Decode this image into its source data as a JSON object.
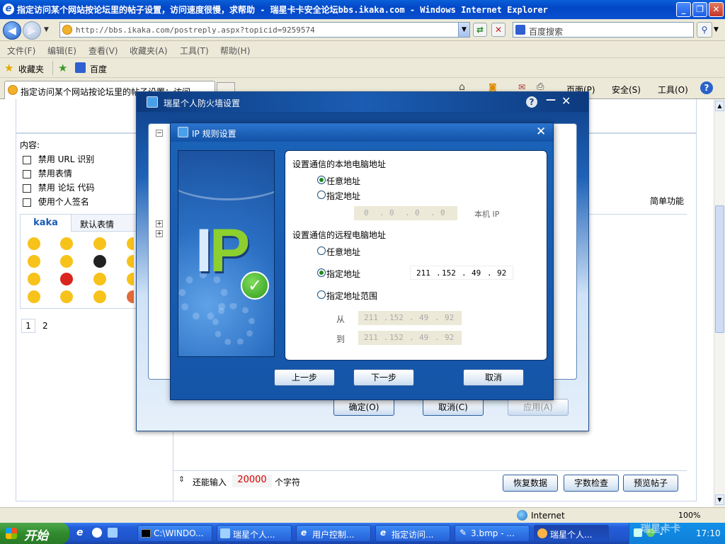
{
  "ie": {
    "title": "指定访问某个网站按论坛里的帖子设置，访问速度很慢，求帮助 - 瑞星卡卡安全论坛bbs.ikaka.com - Windows Internet Explorer",
    "url": "http://bbs.ikaka.com/postreply.aspx?topicid=9259574",
    "search_placeholder": "百度搜索",
    "menu": [
      "文件(F)",
      "编辑(E)",
      "查看(V)",
      "收藏夹(A)",
      "工具(T)",
      "帮助(H)"
    ],
    "favorites_label": "收藏夹",
    "favorite_link": "百度",
    "tab_title": "指定访问某个网站按论坛里的帖子设置：访问...",
    "cmd": {
      "page": "页面(P)",
      "safety": "安全(S)",
      "tools": "工具(O)"
    },
    "status_zone": "Internet",
    "zoom": "100%"
  },
  "forum": {
    "content_label": "内容:",
    "options": [
      "禁用 URL 识别",
      "禁用表情",
      "禁用 论坛 代码",
      "使用个人签名"
    ],
    "smiley_tabs": [
      "kaka",
      "默认表情"
    ],
    "pages": [
      "1",
      "2"
    ],
    "simple_function": "简单功能",
    "remaining_prefix": "还能输入",
    "remaining_count": "20000",
    "remaining_suffix": "个字符",
    "buttons": [
      "恢复数据",
      "字数检查",
      "预览帖子"
    ],
    "partial_link": "认"
  },
  "firewall": {
    "title": "瑞星个人防火墙设置",
    "ok": "确定(O)",
    "cancel": "取消(C)",
    "apply": "应用(A)"
  },
  "ip_rule": {
    "title": "IP 规则设置",
    "local_heading": "设置通信的本地电脑地址",
    "local_any": "任意地址",
    "local_specified": "指定地址",
    "local_ip": [
      "0",
      "0",
      "0",
      "0"
    ],
    "local_ip_hint": "本机 IP",
    "remote_heading": "设置通信的远程电脑地址",
    "remote_any": "任意地址",
    "remote_specified": "指定地址",
    "remote_ip": [
      "211",
      "152",
      "49",
      "92"
    ],
    "remote_range": "指定地址范围",
    "from_label": "从",
    "to_label": "到",
    "range_from": [
      "211",
      "152",
      "49",
      "92"
    ],
    "range_to": [
      "211",
      "152",
      "49",
      "92"
    ],
    "banner_text": "IP",
    "prev": "上一步",
    "next": "下一步",
    "cancel": "取消"
  },
  "taskbar": {
    "start": "开始",
    "items": [
      "C:\\WINDO...",
      "瑞星个人...",
      "用户控制...",
      "指定访问...",
      "3.bmp - ...",
      "瑞星个人..."
    ],
    "clock": "17:10",
    "watermark": "瑞星卡卡"
  }
}
